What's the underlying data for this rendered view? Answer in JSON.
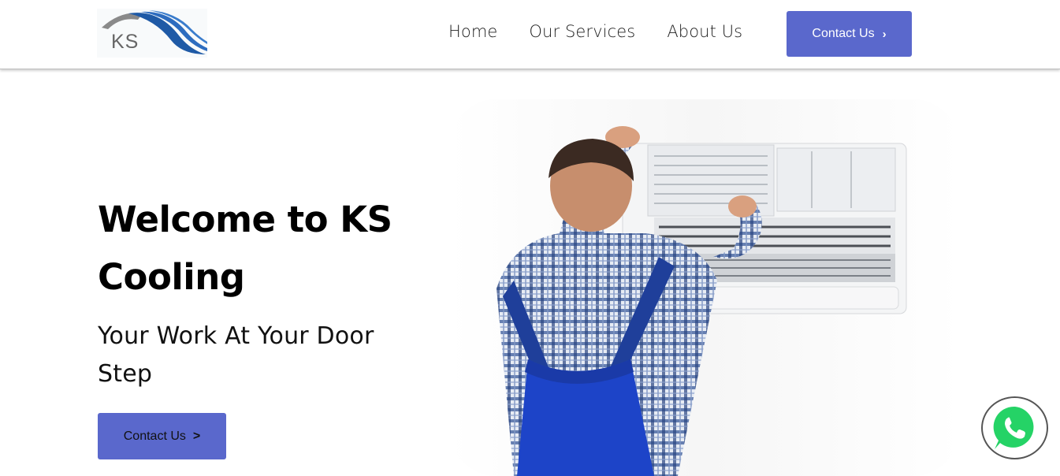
{
  "brand": {
    "logo_text": "KS"
  },
  "nav": {
    "items": [
      {
        "label": "Home"
      },
      {
        "label": "Our Services"
      },
      {
        "label": "About Us"
      }
    ],
    "contact_button": "Contact Us"
  },
  "hero": {
    "title": "Welcome to KS Cooling",
    "subtitle": "Your Work At Your Door Step",
    "cta_label": "Contact Us",
    "image": "technician-installing-ac-unit"
  },
  "floating": {
    "whatsapp_icon": "whatsapp-icon"
  },
  "colors": {
    "accent": "#5a68cc",
    "logo_blue": "#1f5aa6",
    "logo_gray": "#8a8a8a",
    "whatsapp_green": "#25d366"
  }
}
